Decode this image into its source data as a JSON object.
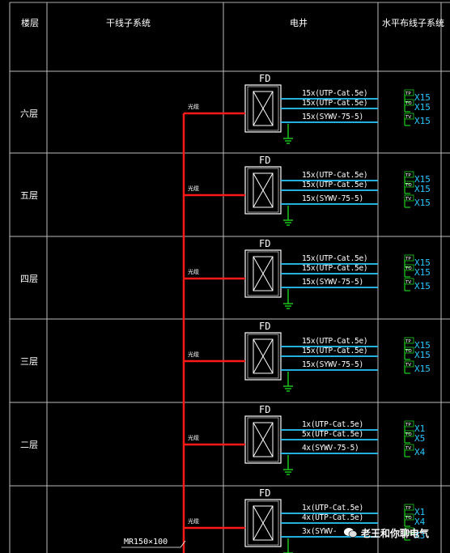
{
  "headers": {
    "floor": "楼层",
    "riser": "干线子系统",
    "shaft": "电井",
    "horizontal": "水平布线子系统"
  },
  "fd_label": "FD",
  "fiber_label": "光缆",
  "mr_label": "MR150×100",
  "watermark": "老王和你聊电气",
  "outlet_tags": [
    "TP",
    "TO",
    "TV"
  ],
  "floors": [
    {
      "name": "六层",
      "cables": [
        "15x(UTP-Cat.5e)",
        "15x(UTP-Cat.5e)",
        "15x(SYWV-75-5)"
      ],
      "outlets": [
        "X15",
        "X15",
        "X15"
      ]
    },
    {
      "name": "五层",
      "cables": [
        "15x(UTP-Cat.5e)",
        "15x(UTP-Cat.5e)",
        "15x(SYWV-75-5)"
      ],
      "outlets": [
        "X15",
        "X15",
        "X15"
      ]
    },
    {
      "name": "四层",
      "cables": [
        "15x(UTP-Cat.5e)",
        "15x(UTP-Cat.5e)",
        "15x(SYWV-75-5)"
      ],
      "outlets": [
        "X15",
        "X15",
        "X15"
      ]
    },
    {
      "name": "三层",
      "cables": [
        "15x(UTP-Cat.5e)",
        "15x(UTP-Cat.5e)",
        "15x(SYWV-75-5)"
      ],
      "outlets": [
        "X15",
        "X15",
        "X15"
      ]
    },
    {
      "name": "二层",
      "cables": [
        "1x(UTP-Cat.5e)",
        "5x(UTP-Cat.5e)",
        "4x(SYWV-75-5)"
      ],
      "outlets": [
        "X1",
        "X5",
        "X4"
      ]
    },
    {
      "name": "",
      "cables": [
        "1x(UTP-Cat.5e)",
        "4x(UTP-Cat.5e)",
        "3x(SYWV-"
      ],
      "outlets": [
        "X1",
        "X4",
        "X3"
      ]
    }
  ]
}
